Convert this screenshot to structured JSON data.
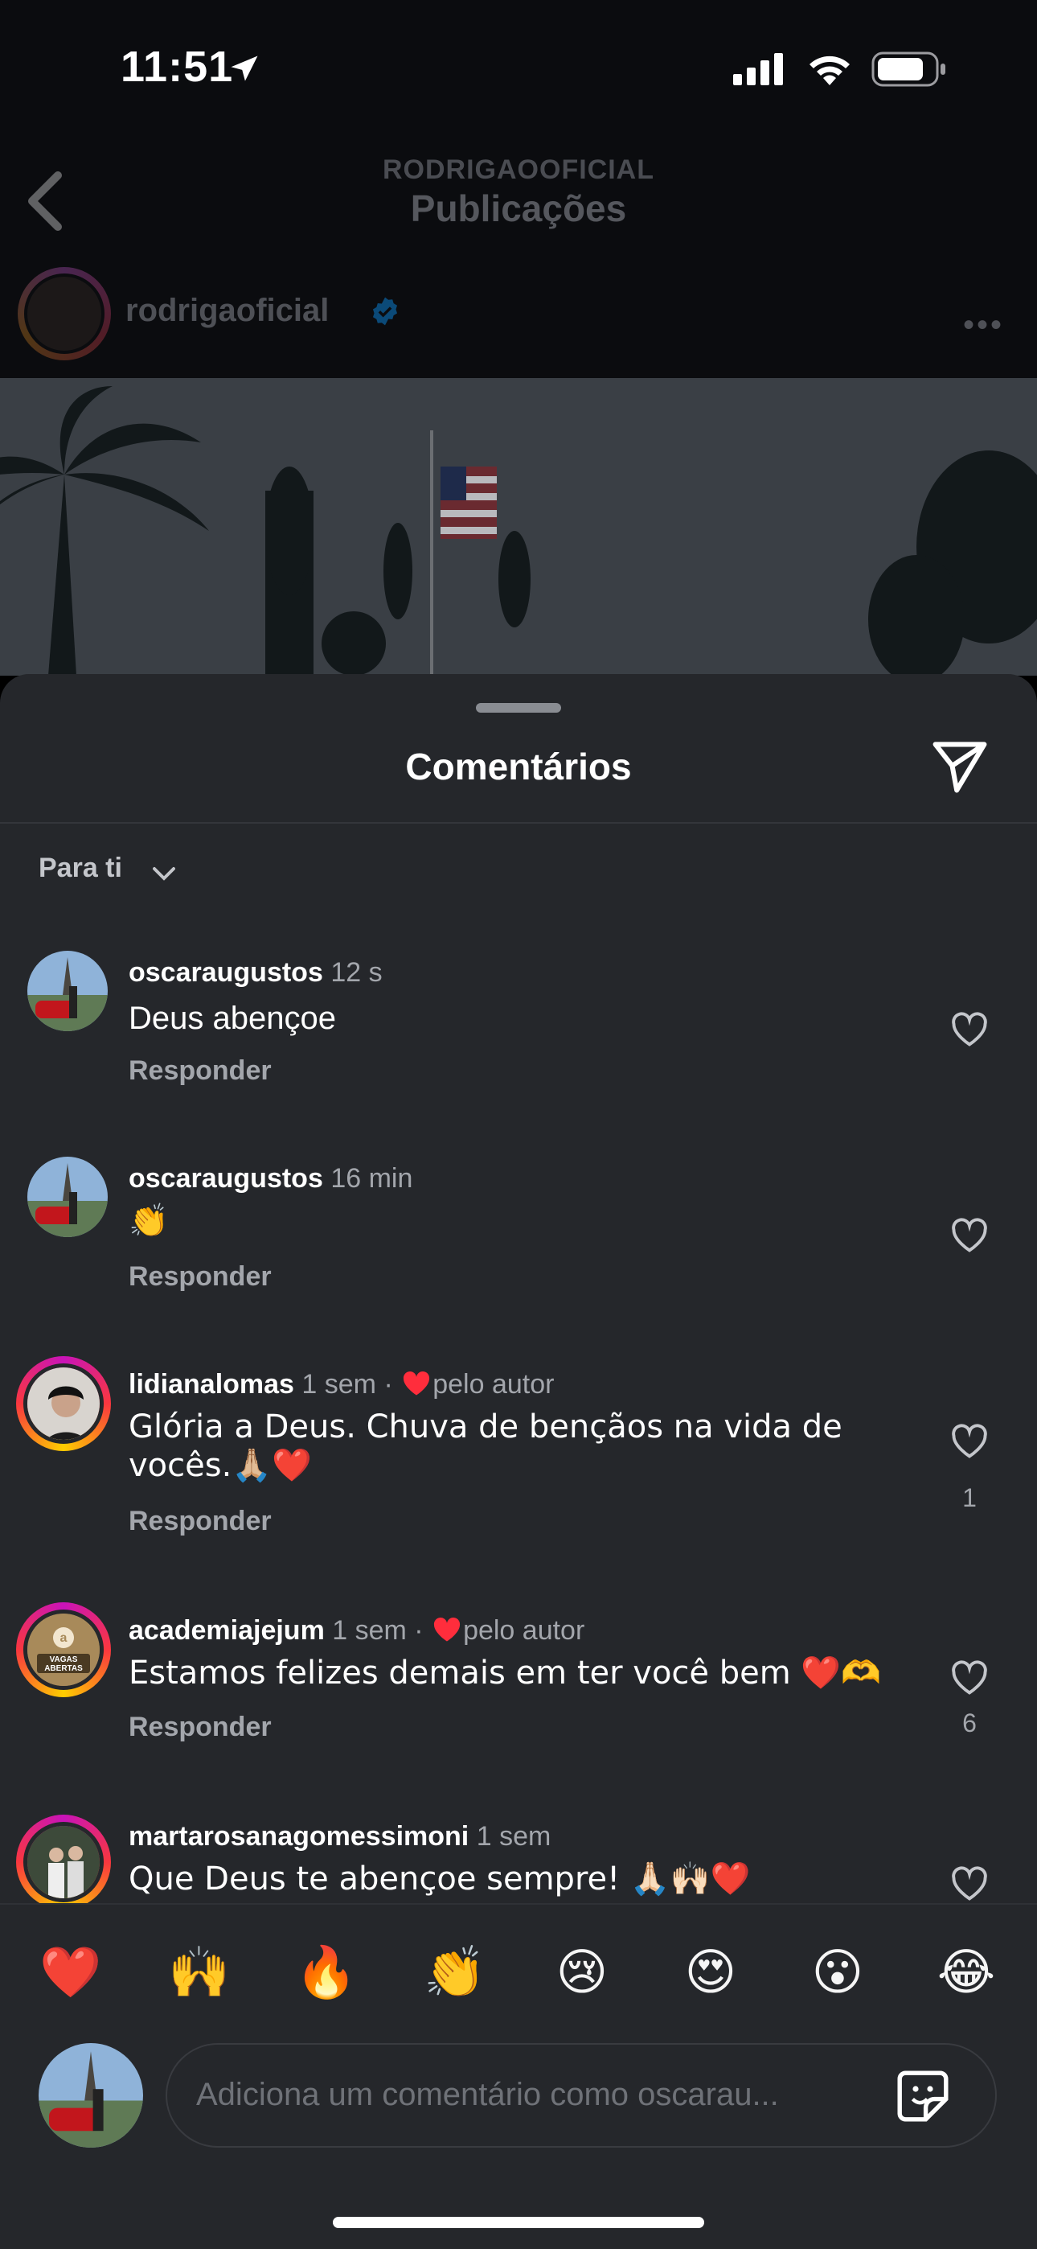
{
  "status_bar": {
    "time": "11:51"
  },
  "nav": {
    "subtitle": "RODRIGAOOFICIAL",
    "title": "Publicações"
  },
  "post": {
    "username": "rodrigaoficial"
  },
  "sheet": {
    "title": "Comentários",
    "filter_label": "Para ti"
  },
  "comments": [
    {
      "username": "oscaraugustos",
      "time": "12 s",
      "text": "Deus abençoe",
      "reply": "Responder"
    },
    {
      "username": "oscaraugustos",
      "time": "16 min",
      "text": "👏",
      "reply": "Responder"
    },
    {
      "username": "lidianalomas",
      "time": "1 sem · ",
      "liked_by": "pelo autor",
      "text": "Glória a Deus. Chuva de bençãos na vida de vocês.🙏🏼❤️",
      "reply": "Responder",
      "likes": "1"
    },
    {
      "username": "academiajejum",
      "time": "1 sem · ",
      "liked_by": "pelo autor",
      "text": "Estamos felizes demais em ter você bem ❤️🫶",
      "reply": "Responder",
      "likes": "6",
      "avatar_text": "VAGAS ABERTAS"
    },
    {
      "username": "martarosanagomessimoni",
      "time": "1 sem",
      "text": "Que Deus te abençoe sempre! 🙏🏻🙌🏻❤️"
    }
  ],
  "reactions": [
    "❤️",
    "🙌",
    "🔥",
    "👏",
    "😢",
    "😍",
    "😮",
    "😂"
  ],
  "composer": {
    "placeholder": "Adiciona um comentário como oscarau..."
  },
  "colors": {
    "sheet_bg": "#25272b",
    "accent_ring": "#c913b9",
    "verified": "#0095f6"
  }
}
